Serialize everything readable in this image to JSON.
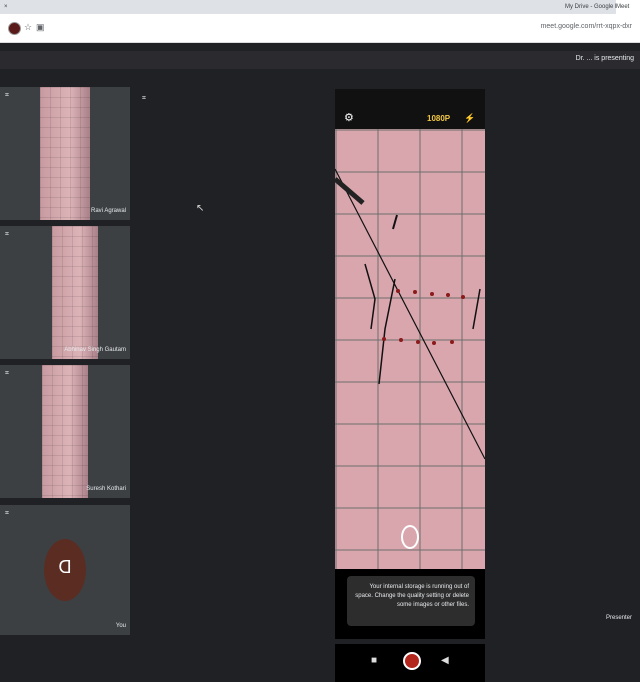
{
  "browser": {
    "tabs": [
      {
        "label": "My Drive - Google Drive",
        "active": false
      },
      {
        "label": "Meet",
        "active": true
      }
    ],
    "url": "meet.google.com/rrt-xqpx-dxr"
  },
  "meet": {
    "presenting_banner": "Dr. ... is presenting",
    "participants": [
      {
        "name": "Ravi Agrawal"
      },
      {
        "name": "Abhinav Singh Gautam"
      },
      {
        "name": "Suresh Kothari"
      },
      {
        "name": "You",
        "initial": "D"
      }
    ],
    "presenter_label": "Presenter"
  },
  "phone": {
    "resolution": "1080P",
    "toast": "Your internal storage is running out of space. Change the quality setting or delete some images or other files."
  },
  "icons": [
    "settings-icon",
    "flash-icon",
    "back-icon",
    "home-icon",
    "recents-icon",
    "pin-icon"
  ],
  "colors": {
    "meet_bg": "#202124",
    "accent": "#f2c744",
    "avatar": "#5b2c22"
  }
}
